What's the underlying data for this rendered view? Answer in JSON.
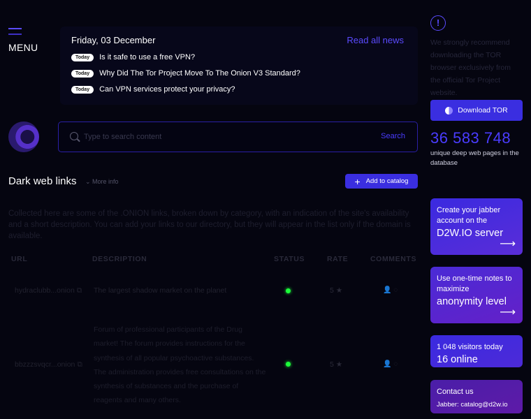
{
  "menu": {
    "label": "MENU"
  },
  "news": {
    "date": "Friday, 03 December",
    "read_all": "Read all news",
    "items": [
      {
        "badge": "Today",
        "title": "Is it safe to use a free VPN?"
      },
      {
        "badge": "Today",
        "title": "Why Did The Tor Project Move To The Onion V3 Standard?"
      },
      {
        "badge": "Today",
        "title": "Can VPN services protect your privacy?"
      }
    ]
  },
  "sidebar": {
    "warn_icon": "!",
    "notice": "We strongly recommend downloading the TOR browser exclusively from the official Tor Project website.",
    "download_label": "Download TOR",
    "count": "36 583 748",
    "count_sub": "unique deep web pages in the database",
    "cards": [
      {
        "small": "Create your jabber account on the",
        "large": "D2W.IO server",
        "arrow": "⟶"
      },
      {
        "small": "Use one-time notes to maximize",
        "large": "anonymity level",
        "arrow": "⟶"
      },
      {
        "small": "1 048 visitors today",
        "large": "16 online"
      },
      {
        "small": "Contact us",
        "sub": "Jabber: catalog@d2w.io"
      }
    ]
  },
  "search": {
    "placeholder": "Type to search content",
    "button": "Search"
  },
  "links": {
    "heading": "Dark web links",
    "more_info": "More info",
    "add_label": "Add to catalog",
    "description": "Collected here are some of the .ONION links, broken down by category, with an indication of the site's availability and a short description. You can add your links to our directory, but they will appear in the list only if the domain is available.",
    "columns": [
      "URL",
      "DESCRIPTION",
      "STATUS",
      "RATE",
      "COMMENTS"
    ],
    "rows": [
      {
        "url": "hydraclubb...onion",
        "description": "The largest shadow market on the planet",
        "rate": "5 ★"
      },
      {
        "url": "bbzzzsvqcr...onion",
        "description": "Forum of professional participants of the Drug market! The forum provides instructions for the synthesis of all popular psychoactive substances. The administration provides free consultations on the synthesis of substances and the purchase of reagents and many others.",
        "rate": "5 ★"
      }
    ]
  },
  "colors": {
    "accent": "#3a2ee0",
    "status_online": "#1bff3a",
    "background": "#050510"
  }
}
